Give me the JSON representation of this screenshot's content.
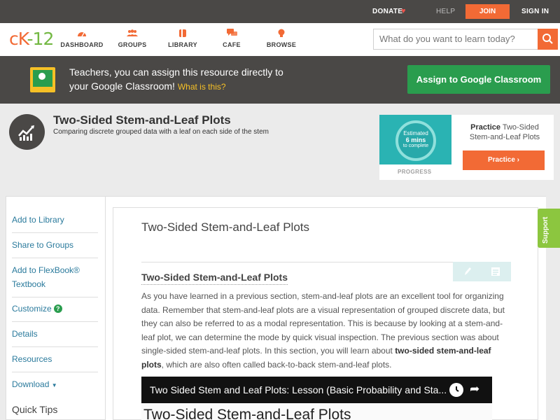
{
  "topbar": {
    "donate": "DONATE",
    "help": "HELP",
    "join": "JOIN",
    "signin": "SIGN IN"
  },
  "logo": {
    "ck": "cK",
    "rest": "-12"
  },
  "nav": {
    "items": [
      {
        "label": "DASHBOARD",
        "icon": "gauge-icon"
      },
      {
        "label": "GROUPS",
        "icon": "people-icon"
      },
      {
        "label": "LIBRARY",
        "icon": "book-icon"
      },
      {
        "label": "CAFE",
        "icon": "chat-icon"
      },
      {
        "label": "BROWSE",
        "icon": "bulb-icon"
      }
    ]
  },
  "search": {
    "placeholder": "What do you want to learn today?"
  },
  "banner": {
    "line1": "Teachers, you can assign this resource directly to",
    "line2": "your Google Classroom!",
    "what_link": "What is this?",
    "assign_button": "Assign to Google Classroom"
  },
  "concept": {
    "title": "Two-Sided Stem-and-Leaf Plots",
    "subtitle": "Comparing discrete grouped data with a leaf on each side of the stem"
  },
  "practice_card": {
    "estimated": "Estimated",
    "mins": "6 mins",
    "to_complete": "to complete",
    "progress_label": "PROGRESS",
    "title_bold": "Practice",
    "title_rest": "Two-Sided Stem-and-Leaf Plots",
    "button": "Practice"
  },
  "sidebar": {
    "add_library": "Add to Library",
    "share_groups": "Share to Groups",
    "add_flexbook": "Add to FlexBook®",
    "add_flexbook2": "Textbook",
    "customize": "Customize",
    "details": "Details",
    "resources": "Resources",
    "download": "Download",
    "quick_tips": "Quick Tips"
  },
  "main": {
    "lesson_title": "Two-Sided Stem-and-Leaf Plots",
    "section_heading": "Two-Sided Stem-and-Leaf Plots",
    "body_pre": "As you have learned in a previous section, stem-and-leaf plots are an excellent tool for organizing data. Remember that stem-and-leaf plots are a visual representation of grouped discrete data, but they can also be referred to as a modal representation. This is because by looking at a stem-and-leaf plot, we can determine the mode by quick visual inspection. The previous section was about single-sided stem-and-leaf plots. In this section, you will learn about ",
    "body_bold": "two-sided stem-and-leaf plots",
    "body_post": ", which are also often called back-to-back stem-and-leaf plots.",
    "video_title": "Two Sided Stem and Leaf Plots: Lesson (Basic Probability and Sta...",
    "video_frame_text": "Two-Sided Stem-and-Leaf Plots"
  },
  "support_tab": "Support",
  "colors": {
    "accent": "#f26a35",
    "brand_green": "#73b843",
    "classroom_green": "#2a9d4e",
    "link": "#2a7a9c"
  }
}
